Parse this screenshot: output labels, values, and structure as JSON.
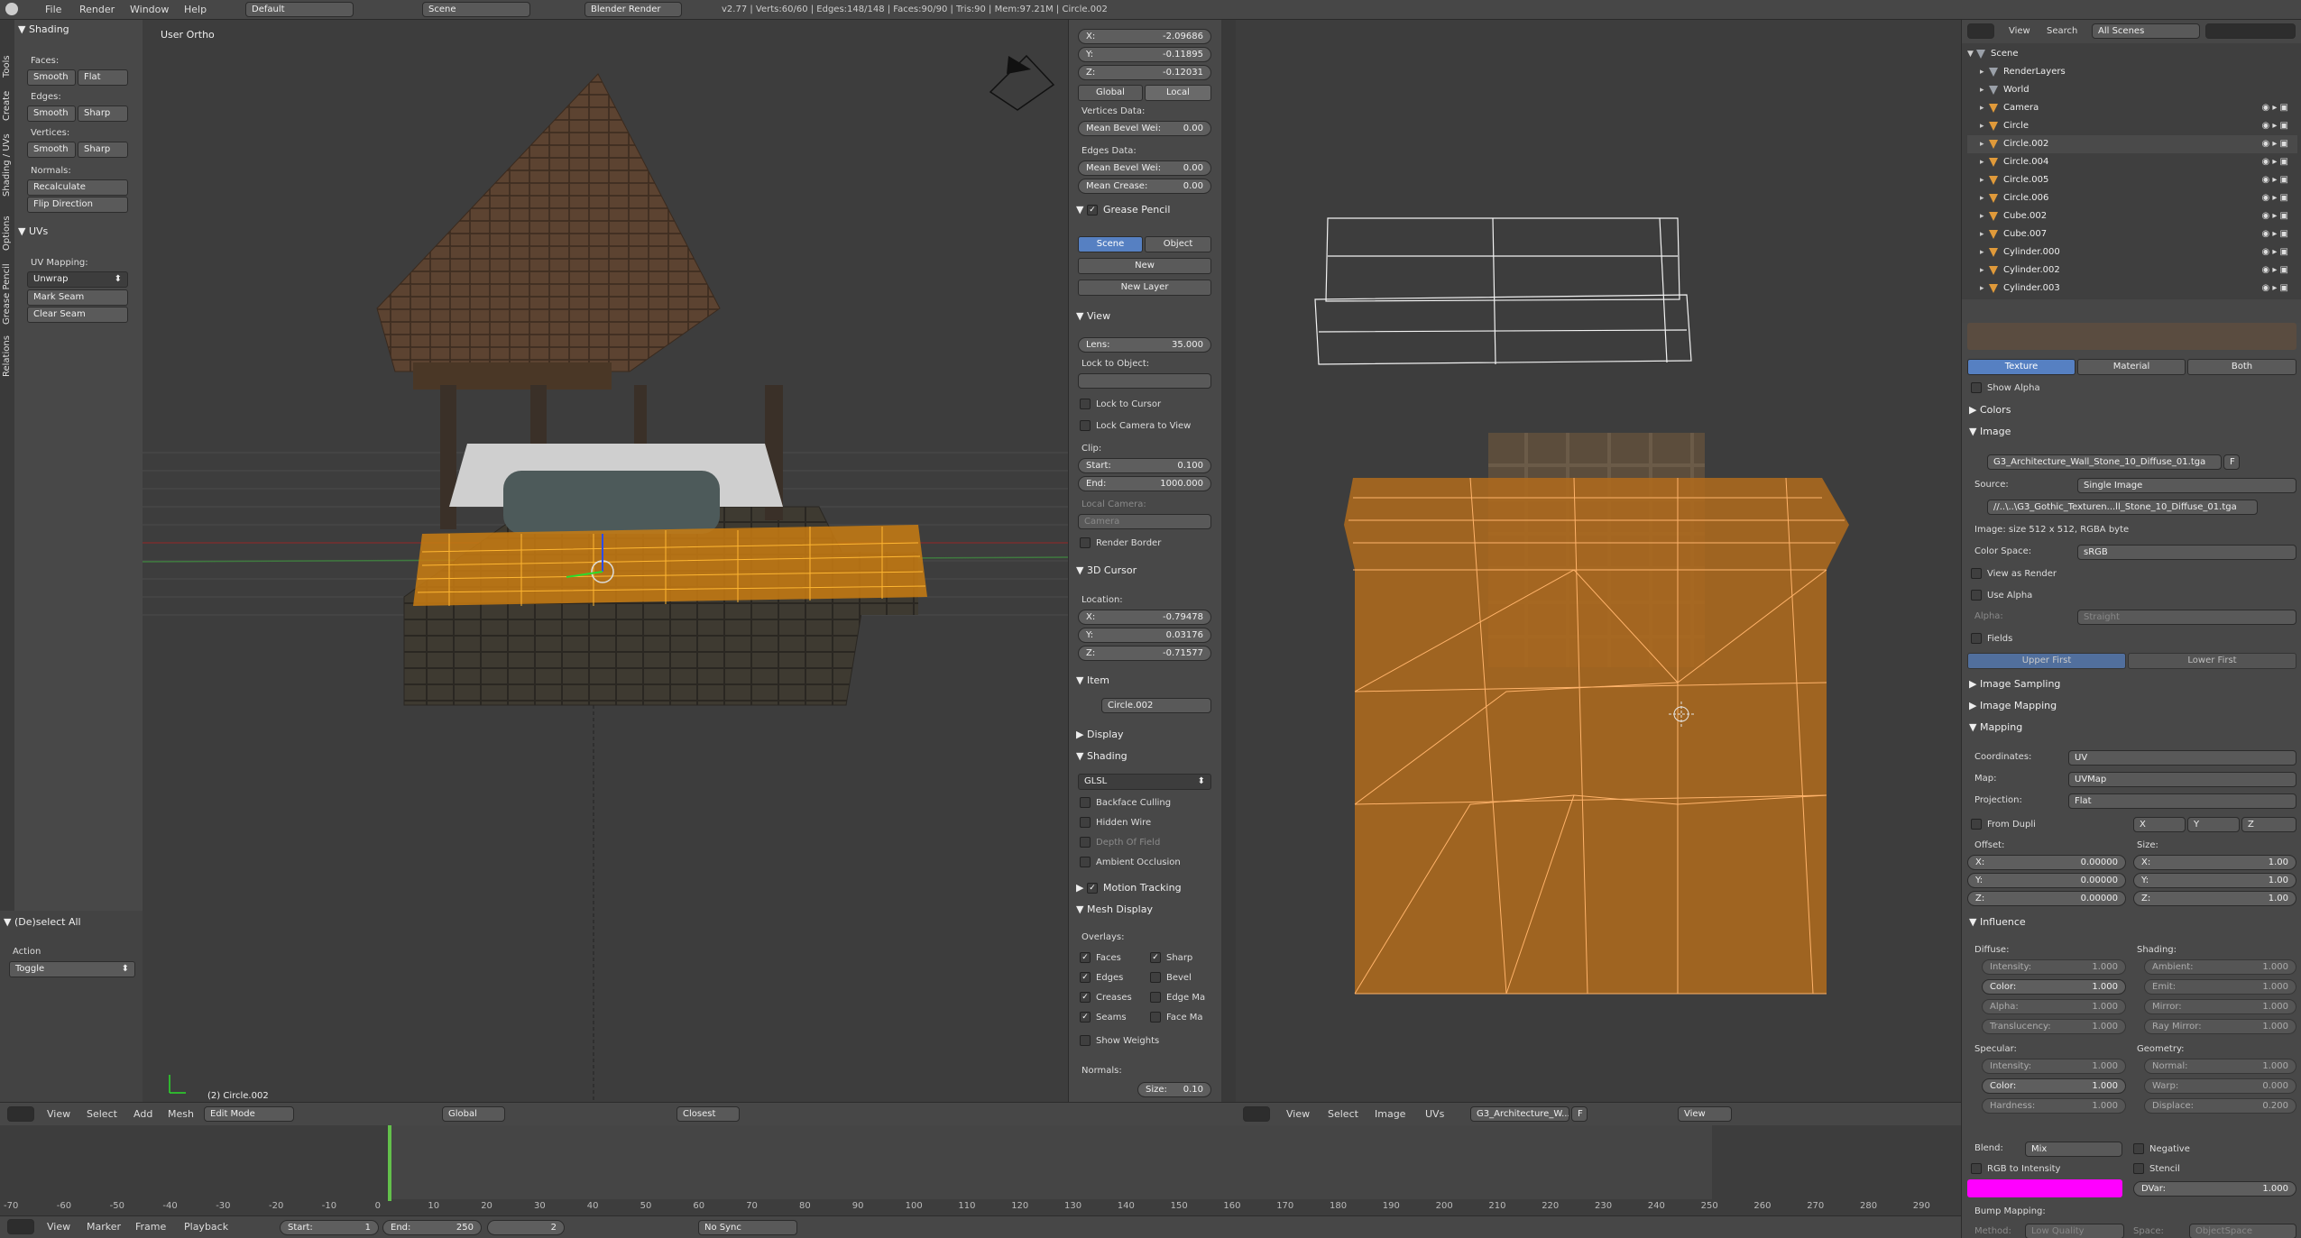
{
  "topbar": {
    "menus": [
      "File",
      "Render",
      "Window",
      "Help"
    ],
    "layout": "Default",
    "scene": "Scene",
    "engine": "Blender Render",
    "stats": "v2.77 | Verts:60/60 | Edges:148/148 | Faces:90/90 | Tris:90 | Mem:97.21M | Circle.002"
  },
  "tabs": [
    "Tools",
    "Create",
    "Shading / UVs",
    "Options",
    "Grease Pencil",
    "Relations"
  ],
  "tool": {
    "shading_title": "Shading",
    "faces": "Faces:",
    "edges": "Edges:",
    "vertices": "Vertices:",
    "smooth": "Smooth",
    "flat": "Flat",
    "sharp": "Sharp",
    "normals": "Normals:",
    "recalc": "Recalculate",
    "flip": "Flip Direction",
    "uvs_title": "UVs",
    "uv_mapping": "UV Mapping:",
    "unwrap": "Unwrap",
    "mark_seam": "Mark Seam",
    "clear_seam": "Clear Seam",
    "op_title": "(De)select All",
    "action": "Action",
    "toggle": "Toggle"
  },
  "viewport": {
    "label": "User Ortho",
    "object": "(2) Circle.002"
  },
  "npanel": {
    "x": "-2.09686",
    "y": "-0.11895",
    "z": "-0.12031",
    "global": "Global",
    "local": "Local",
    "vdata": "Vertices Data:",
    "mbw": "Mean Bevel Wei:",
    "mbw_v": "0.00",
    "edata": "Edges Data:",
    "mbw2_v": "0.00",
    "mcrease": "Mean Crease:",
    "mcrease_v": "0.00",
    "gp": "Grease Pencil",
    "scene": "Scene",
    "object": "Object",
    "new": "New",
    "new_layer": "New Layer",
    "view": "View",
    "lens": "Lens:",
    "lens_v": "35.000",
    "lock_obj": "Lock to Object:",
    "lock_cursor": "Lock to Cursor",
    "lock_cam": "Lock Camera to View",
    "clip": "Clip:",
    "start": "Start:",
    "start_v": "0.100",
    "end": "End:",
    "end_v": "1000.000",
    "local_cam": "Local Camera:",
    "camera": "Camera",
    "render_border": "Render Border",
    "cursor3d": "3D Cursor",
    "location": "Location:",
    "cx": "-0.79478",
    "cy": "0.03176",
    "cz": "-0.71577",
    "item": "Item",
    "item_name": "Circle.002",
    "display": "Display",
    "shading": "Shading",
    "glsl": "GLSL",
    "backface": "Backface Culling",
    "hidden_wire": "Hidden Wire",
    "dof": "Depth Of Field",
    "ao": "Ambient Occlusion",
    "motion": "Motion Tracking",
    "mesh_display": "Mesh Display",
    "overlays": "Overlays:",
    "faces": "Faces",
    "sharp": "Sharp",
    "edges": "Edges",
    "bevel": "Bevel",
    "creases": "Creases",
    "edge_ma": "Edge Ma",
    "seams": "Seams",
    "face_ma": "Face Ma",
    "show_weights": "Show Weights",
    "normals": "Normals:",
    "size": "Size:",
    "size_v": "0.10"
  },
  "v3dheader": {
    "menus": [
      "View",
      "Select",
      "Add",
      "Mesh"
    ],
    "mode": "Edit Mode",
    "orient": "Global",
    "snap": "Closest"
  },
  "uvheader": {
    "menus": [
      "View",
      "Select",
      "Image",
      "UVs"
    ],
    "image": "G3_Architecture_W...",
    "f": "F",
    "view": "View"
  },
  "timeline": {
    "ticks": [
      "-70",
      "-60",
      "-50",
      "-40",
      "-30",
      "-20",
      "-10",
      "0",
      "10",
      "20",
      "30",
      "40",
      "50",
      "60",
      "70",
      "80",
      "90",
      "100",
      "110",
      "120",
      "130",
      "140",
      "150",
      "160",
      "170",
      "180",
      "190",
      "200",
      "210",
      "220",
      "230",
      "240",
      "250",
      "260",
      "270",
      "280",
      "290"
    ],
    "menus": [
      "View",
      "Marker",
      "Frame",
      "Playback"
    ],
    "start": "Start:",
    "start_v": "1",
    "end": "End:",
    "end_v": "250",
    "cur": "2",
    "sync": "No Sync"
  },
  "outliner": {
    "menus": [
      "View",
      "Search"
    ],
    "filter": "All Scenes",
    "items": [
      "Scene",
      "RenderLayers",
      "World",
      "Camera",
      "Circle",
      "Circle.002",
      "Circle.004",
      "Circle.005",
      "Circle.006",
      "Cube.002",
      "Cube.007",
      "Cylinder.000",
      "Cylinder.002",
      "Cylinder.003"
    ]
  },
  "props": {
    "texture": "Texture",
    "material": "Material",
    "both": "Both",
    "show_alpha": "Show Alpha",
    "colors": "Colors",
    "image": "Image",
    "img_name": "G3_Architecture_Wall_Stone_10_Diffuse_01.tga",
    "f": "F",
    "source": "Source:",
    "source_v": "Single Image",
    "path": "//..\\..\\G3_Gothic_Texturen...ll_Stone_10_Diffuse_01.tga",
    "img_info": "Image: size 512 x 512, RGBA byte",
    "colorspace": "Color Space:",
    "colorspace_v": "sRGB",
    "view_render": "View as Render",
    "use_alpha": "Use Alpha",
    "alpha": "Alpha:",
    "alpha_v": "Straight",
    "fields": "Fields",
    "upper": "Upper First",
    "lower": "Lower First",
    "sampling": "Image Sampling",
    "imapping": "Image Mapping",
    "mapping": "Mapping",
    "coords": "Coordinates:",
    "coords_v": "UV",
    "map": "Map:",
    "map_v": "UVMap",
    "projection": "Projection:",
    "projection_v": "Flat",
    "from_dupli": "From Dupli",
    "x": "X",
    "y": "Y",
    "z": "Z",
    "offset": "Offset:",
    "size": "Size:",
    "off_v": "0.00000",
    "size_v": "1.00",
    "influence": "Influence",
    "diffuse": "Diffuse:",
    "shading": "Shading:",
    "intensity": "Intensity:",
    "one": "1.000",
    "color": "Color:",
    "alpha_l": "Alpha:",
    "transl": "Translucency:",
    "ambient": "Ambient:",
    "emit": "Emit:",
    "mirror": "Mirror:",
    "raymirror": "Ray Mirror:",
    "specular": "Specular:",
    "geometry": "Geometry:",
    "hardness": "Hardness:",
    "normal": "Normal:",
    "warp": "Warp:",
    "zero": "0.000",
    "displace": "Displace:",
    "disp_v": "0.200",
    "blend": "Blend:",
    "blend_v": "Mix",
    "negative": "Negative",
    "rgb_int": "RGB to Intensity",
    "stencil": "Stencil",
    "dvar": "DVar:",
    "dvar_v": "1.000",
    "bump": "Bump Mapping:",
    "method": "Method:",
    "method_v": "Low Quality",
    "space": "Space:",
    "space_v": "ObjectSpace",
    "accent": "#ff00ff"
  }
}
